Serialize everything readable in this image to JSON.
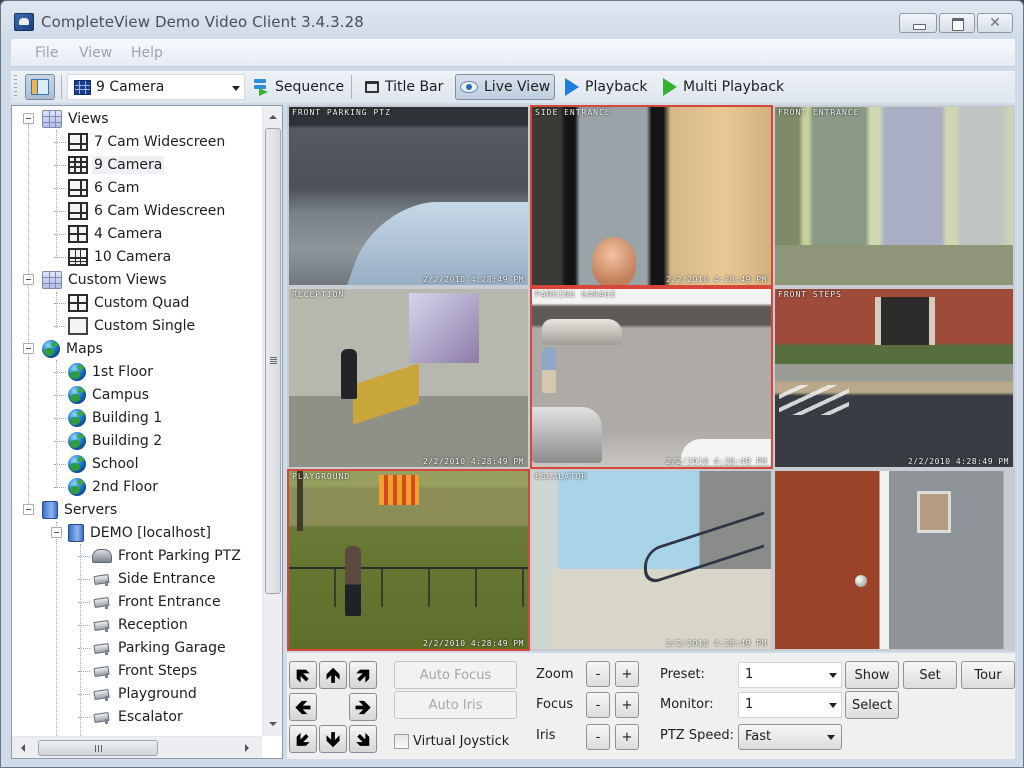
{
  "window": {
    "title": "CompleteView Demo Video Client 3.4.3.28",
    "controls": {
      "minimize": "minimize",
      "maximize": "maximize",
      "close": "✕"
    }
  },
  "menu": [
    "File",
    "View",
    "Help"
  ],
  "toolbar": {
    "view_select": "9 Camera",
    "sequence": "Sequence",
    "title_bar": "Title Bar",
    "live_view": "Live View",
    "playback": "Playback",
    "multi_playback": "Multi Playback"
  },
  "tree": {
    "views": {
      "label": "Views",
      "items": [
        {
          "label": "7 Cam Widescreen",
          "icon": "layout-7-icon"
        },
        {
          "label": "9 Camera",
          "icon": "layout-9-icon",
          "selected": true
        },
        {
          "label": "6 Cam",
          "icon": "layout-6-icon"
        },
        {
          "label": "6 Cam Widescreen",
          "icon": "layout-6-wide-icon"
        },
        {
          "label": "4 Camera",
          "icon": "layout-4-icon"
        },
        {
          "label": "10 Camera",
          "icon": "layout-10-icon"
        }
      ]
    },
    "custom_views": {
      "label": "Custom Views",
      "items": [
        {
          "label": "Custom Quad",
          "icon": "layout-4-icon"
        },
        {
          "label": "Custom Single",
          "icon": "layout-1-icon"
        }
      ]
    },
    "maps": {
      "label": "Maps",
      "items": [
        "1st Floor",
        "Campus",
        "Building 1",
        "Building 2",
        "School",
        "2nd Floor"
      ]
    },
    "servers": {
      "label": "Servers",
      "server": "DEMO [localhost]",
      "cameras": [
        {
          "label": "Front Parking PTZ",
          "type": "ptz"
        },
        {
          "label": "Side Entrance",
          "type": "fixed"
        },
        {
          "label": "Front Entrance",
          "type": "fixed"
        },
        {
          "label": "Reception",
          "type": "fixed"
        },
        {
          "label": "Parking Garage",
          "type": "fixed"
        },
        {
          "label": "Front Steps",
          "type": "fixed"
        },
        {
          "label": "Playground",
          "type": "fixed"
        },
        {
          "label": "Escalator",
          "type": "fixed"
        }
      ]
    }
  },
  "cameras": [
    {
      "name": "FRONT PARKING PTZ",
      "time": "2/2/2010 4:28:49 PM",
      "active": false
    },
    {
      "name": "SIDE ENTRANCE",
      "time": "2/2/2010 4:28:49 PM",
      "active": true
    },
    {
      "name": "FRONT ENTRANCE",
      "time": "",
      "active": false
    },
    {
      "name": "RECEPTION",
      "time": "2/2/2010 4:28:49 PM",
      "active": false
    },
    {
      "name": "PARKING GARAGE",
      "time": "2/2/2010 4:28:49 PM",
      "active": true
    },
    {
      "name": "FRONT STEPS",
      "time": "2/2/2010 4:28:49 PM",
      "active": false
    },
    {
      "name": "PLAYGROUND",
      "time": "2/2/2010 4:28:49 PM",
      "active": true
    },
    {
      "name": "ESCALATOR",
      "time": "2/2/2010 4:28:49 PM",
      "active": false
    },
    {
      "name": "",
      "time": "",
      "active": false
    }
  ],
  "ptz": {
    "auto_focus": "Auto Focus",
    "auto_iris": "Auto Iris",
    "virtual_joystick": "Virtual Joystick",
    "virtual_joystick_checked": false,
    "zoom": "Zoom",
    "focus": "Focus",
    "iris": "Iris",
    "minus": "-",
    "plus": "+",
    "preset_label": "Preset:",
    "preset_value": "1",
    "monitor_label": "Monitor:",
    "monitor_value": "1",
    "speed_label": "PTZ Speed:",
    "speed_value": "Fast",
    "show": "Show",
    "set": "Set",
    "tour": "Tour",
    "select": "Select",
    "arrows": {
      "nw": "🡼",
      "n": "🡹",
      "ne": "🡽",
      "w": "🡸",
      "e": "🡺",
      "sw": "🡿",
      "s": "🡻",
      "se": "🡾"
    }
  },
  "colors": {
    "active_border": "#d8463a",
    "playback": "#1f7de0",
    "multi_playback": "#36b030"
  }
}
